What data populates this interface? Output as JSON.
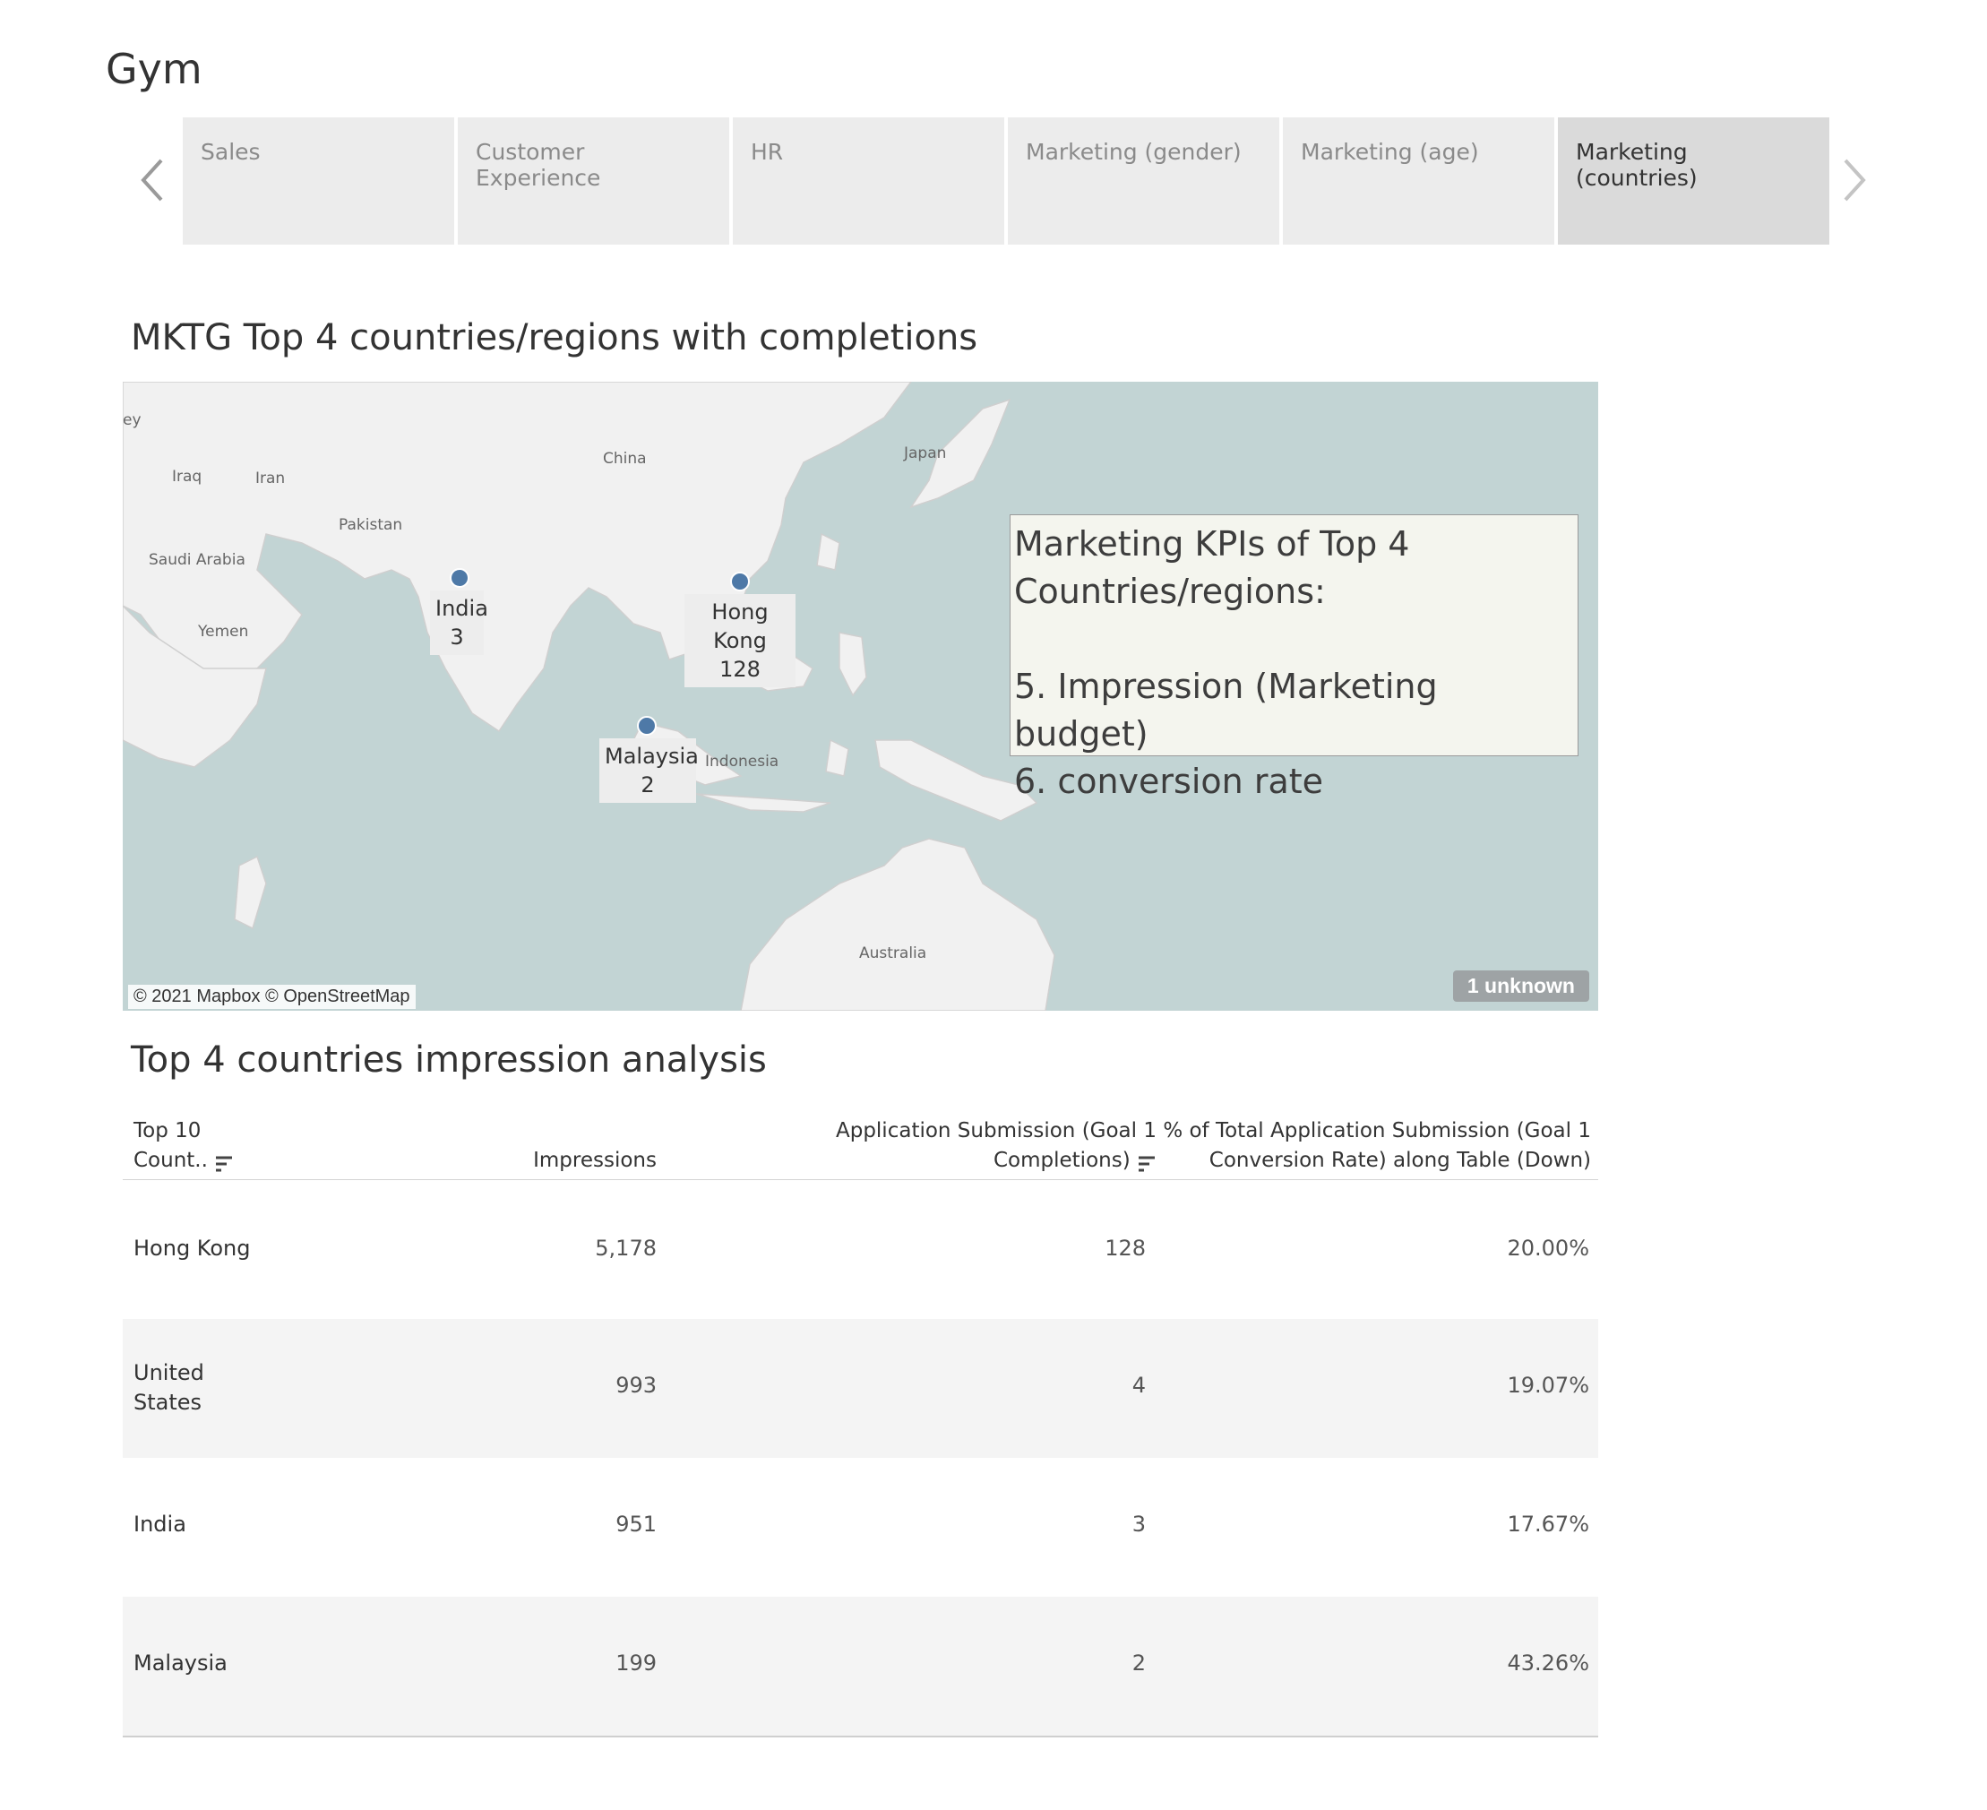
{
  "app": {
    "title": "Gym"
  },
  "tabs": [
    {
      "label": "Sales",
      "active": false
    },
    {
      "label": "Customer Experience",
      "active": false
    },
    {
      "label": "HR",
      "active": false
    },
    {
      "label": "Marketing (gender)",
      "active": false
    },
    {
      "label": "Marketing (age)",
      "active": false
    },
    {
      "label": "Marketing (countries)",
      "active": true
    }
  ],
  "map_section": {
    "title": "MKTG Top 4 countries/regions with completions",
    "places": [
      "ey",
      "Iraq",
      "Iran",
      "China",
      "Japan",
      "Pakistan",
      "Saudi Arabia",
      "Yemen",
      "Indonesia",
      "Australia"
    ],
    "markers": [
      {
        "name": "India",
        "value": "3"
      },
      {
        "name": "Hong Kong",
        "value": "128"
      },
      {
        "name": "Malaysia",
        "value": "2"
      }
    ],
    "kpi_lines": [
      "Marketing KPIs of Top 4",
      "Countries/regions:",
      "",
      "5. Impression (Marketing budget)",
      "6. conversion rate"
    ],
    "attribution": "© 2021 Mapbox © OpenStreetMap",
    "unknown_badge": "1 unknown",
    "colors": {
      "water": "#c2d4d4",
      "land": "#f1f1f1",
      "marker": "#4e79a7"
    }
  },
  "table_section": {
    "title": "Top 4 countries  impression analysis",
    "headers": {
      "country_line1": "Top 10",
      "country_line2": "Count..",
      "impressions": "Impressions",
      "submission_line1": "Application Submission (Goal 1",
      "submission_line2": "Completions)",
      "pct_line1": "% of Total Application Submission (Goal 1",
      "pct_line2": "Conversion Rate) along Table (Down)"
    },
    "rows": [
      {
        "name_line1": "Hong Kong",
        "name_line2": "",
        "impressions": "5,178",
        "submissions": "128",
        "pct": "20.00%"
      },
      {
        "name_line1": "United",
        "name_line2": "States",
        "impressions": "993",
        "submissions": "4",
        "pct": "19.07%"
      },
      {
        "name_line1": "India",
        "name_line2": "",
        "impressions": "951",
        "submissions": "3",
        "pct": "17.67%"
      },
      {
        "name_line1": "Malaysia",
        "name_line2": "",
        "impressions": "199",
        "submissions": "2",
        "pct": "43.26%"
      }
    ]
  }
}
